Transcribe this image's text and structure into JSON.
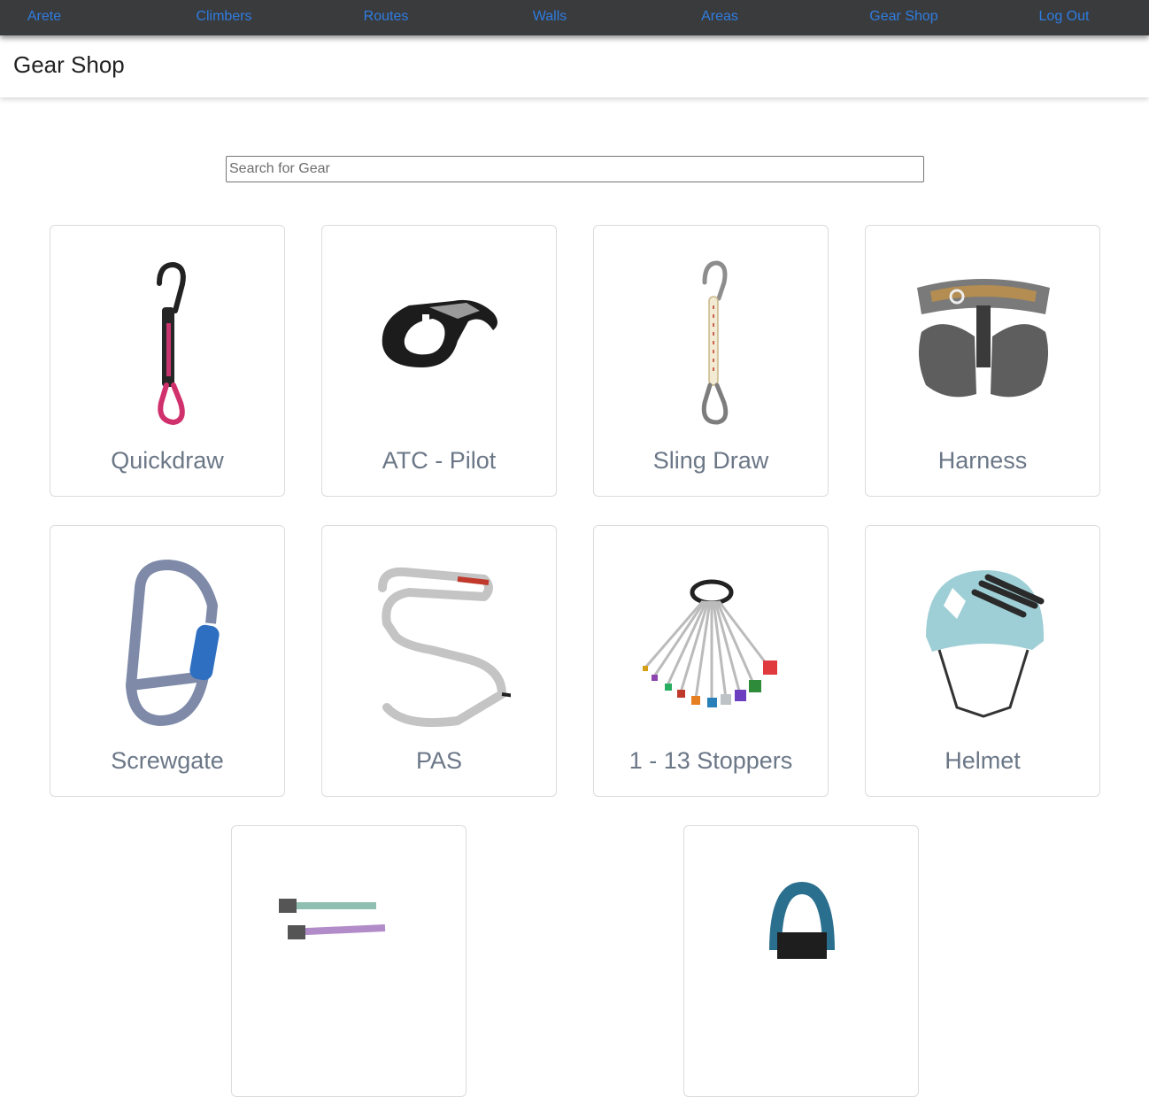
{
  "nav": {
    "items": [
      "Arete",
      "Climbers",
      "Routes",
      "Walls",
      "Areas",
      "Gear Shop",
      "Log Out"
    ]
  },
  "header": {
    "title": "Gear Shop"
  },
  "search": {
    "placeholder": "Search for Gear",
    "value": ""
  },
  "gear": [
    {
      "name": "Quickdraw",
      "icon": "quickdraw-icon"
    },
    {
      "name": "ATC - Pilot",
      "icon": "belay-device-icon"
    },
    {
      "name": "Sling Draw",
      "icon": "sling-draw-icon"
    },
    {
      "name": "Harness",
      "icon": "harness-icon"
    },
    {
      "name": "Screwgate",
      "icon": "screwgate-carabiner-icon"
    },
    {
      "name": "PAS",
      "icon": "pas-icon"
    },
    {
      "name": "1 - 13 Stoppers",
      "icon": "stoppers-icon"
    },
    {
      "name": "Helmet",
      "icon": "helmet-icon"
    },
    {
      "name": "",
      "icon": "cams-icon"
    },
    {
      "name": "",
      "icon": "rope-icon"
    }
  ],
  "colors": {
    "link": "#2f7de1",
    "nav_bg": "#3a3b3d",
    "card_title": "#6b7787"
  }
}
